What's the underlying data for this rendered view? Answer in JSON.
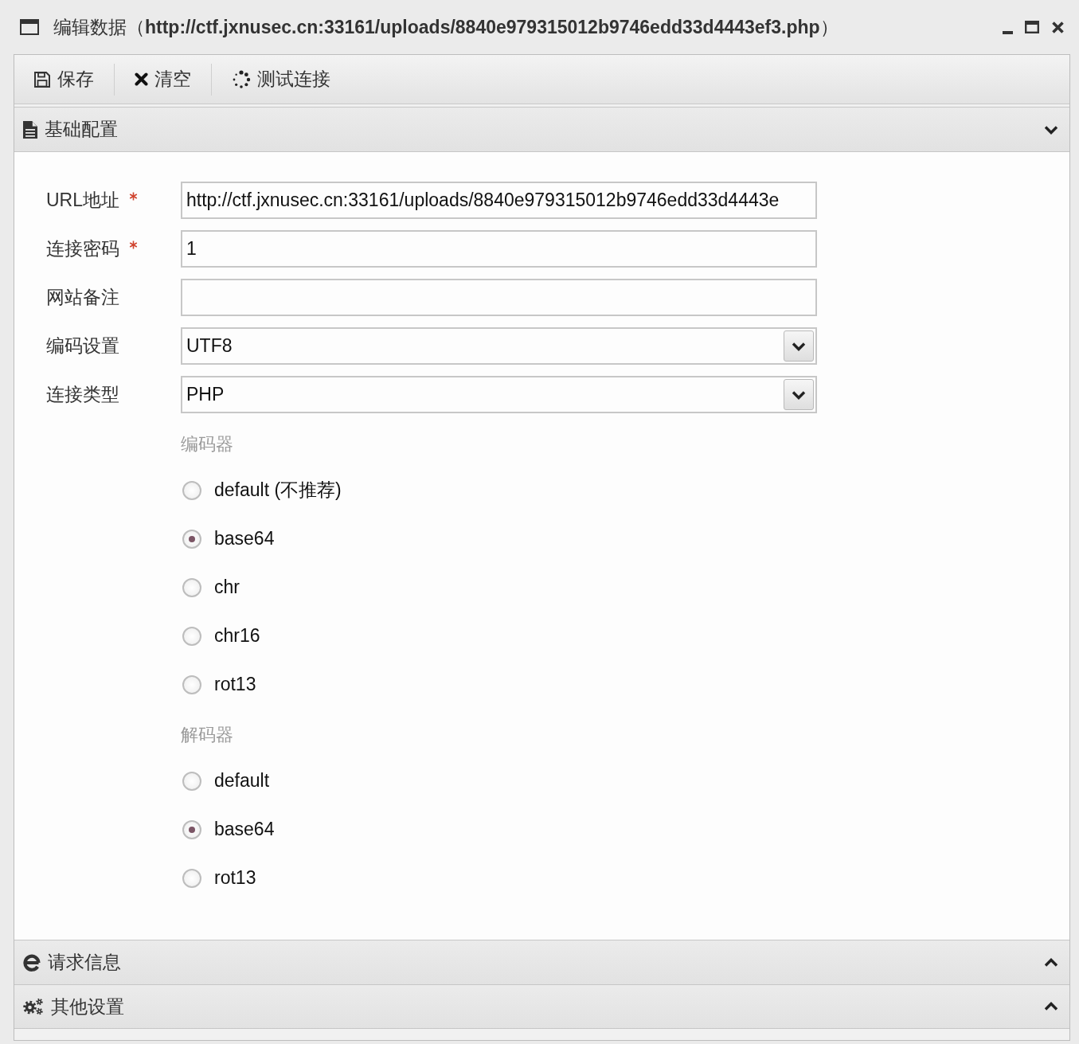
{
  "window": {
    "title": "编辑数据（**http://ctf.jxnusec.cn:33161/uploads/8840e979315012b9746edd33d4443ef3.php**）"
  },
  "toolbar": {
    "buttons": [
      {
        "kind": "save",
        "label": "保存"
      },
      {
        "kind": "clear",
        "label": "清空"
      },
      {
        "kind": "test",
        "label": "测试连接"
      }
    ]
  },
  "panels": [
    {
      "kind": "basic",
      "title": "基础配置",
      "expanded": true,
      "fields": [
        {
          "kind": "text",
          "label": "URL地址",
          "required": true,
          "value": "http://ctf.jxnusec.cn:33161/uploads/8840e979315012b9746edd33d4443e"
        },
        {
          "kind": "text",
          "label": "连接密码",
          "required": true,
          "value": "1"
        },
        {
          "kind": "text",
          "label": "网站备注",
          "required": false
        },
        {
          "kind": "select",
          "label": "编码设置",
          "required": false,
          "value": "UTF8"
        },
        {
          "kind": "select",
          "label": "连接类型",
          "required": false,
          "value": "PHP"
        }
      ],
      "encoder": {
        "title": "编码器",
        "options": [
          {
            "label": "default (不推荐)",
            "selected": false
          },
          {
            "label": "base64",
            "selected": true
          },
          {
            "label": "chr",
            "selected": false
          },
          {
            "label": "chr16",
            "selected": false
          },
          {
            "label": "rot13",
            "selected": false
          }
        ]
      },
      "decoder": {
        "title": "解码器",
        "options": [
          {
            "label": "default",
            "selected": false
          },
          {
            "label": "base64",
            "selected": true
          },
          {
            "label": "rot13",
            "selected": false
          }
        ]
      }
    },
    {
      "kind": "request",
      "title": "请求信息",
      "expanded": false
    },
    {
      "kind": "other",
      "title": "其他设置",
      "expanded": false
    }
  ]
}
